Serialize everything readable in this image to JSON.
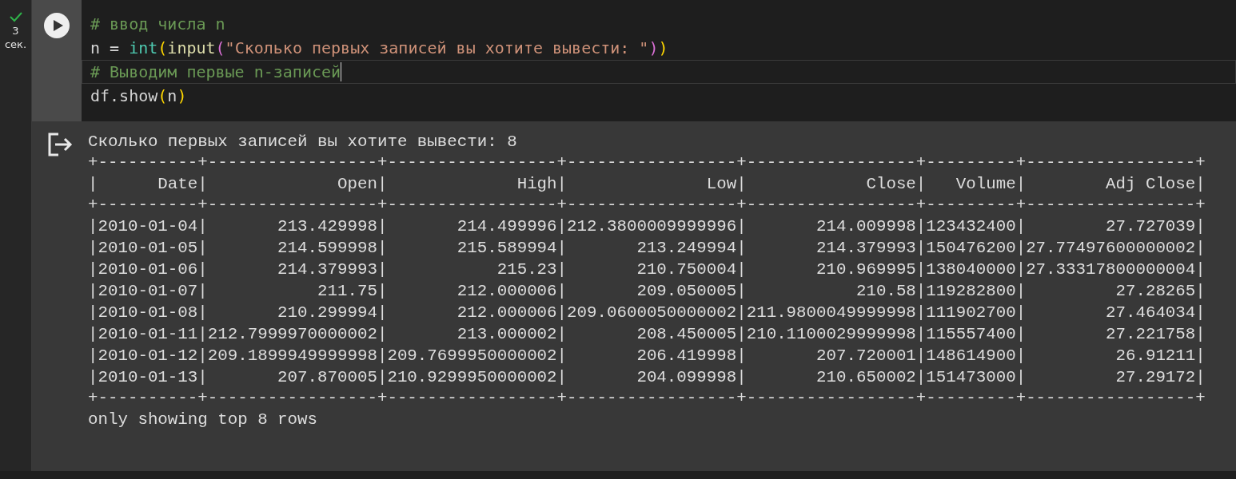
{
  "cell": {
    "succeeded": true,
    "duration": "3 сек.",
    "code": [
      {
        "current": false,
        "tokens": [
          {
            "kind": "comment",
            "text": "# ввод числа n"
          }
        ]
      },
      {
        "current": false,
        "tokens": [
          {
            "kind": "plain",
            "text": "n = "
          },
          {
            "kind": "builtin",
            "text": "int"
          },
          {
            "kind": "bracket1",
            "text": "("
          },
          {
            "kind": "function",
            "text": "input"
          },
          {
            "kind": "bracket2",
            "text": "("
          },
          {
            "kind": "string",
            "text": "\"Сколько первых записей вы хотите вывести: \""
          },
          {
            "kind": "bracket2",
            "text": ")"
          },
          {
            "kind": "bracket1",
            "text": ")"
          }
        ]
      },
      {
        "current": true,
        "tokens": [
          {
            "kind": "comment",
            "text": "# Выводим первые n-записей"
          }
        ]
      },
      {
        "current": false,
        "tokens": [
          {
            "kind": "plain",
            "text": "df.show"
          },
          {
            "kind": "bracket1",
            "text": "("
          },
          {
            "kind": "plain",
            "text": "n"
          },
          {
            "kind": "bracket1",
            "text": ")"
          }
        ]
      }
    ],
    "output": {
      "lines": [
        {
          "kind": "text",
          "text": "Сколько первых записей вы хотите вывести: 8"
        },
        {
          "kind": "border",
          "text": "+----------+-----------------+-----------------+-----------------+-----------------+---------+-----------------+"
        },
        {
          "kind": "header",
          "text": "|      Date|             Open|             High|              Low|            Close|   Volume|        Adj Close|"
        },
        {
          "kind": "border",
          "text": "+----------+-----------------+-----------------+-----------------+-----------------+---------+-----------------+"
        },
        {
          "kind": "row",
          "text": "|2010-01-04|       213.429998|       214.499996|212.3800009999996|       214.009998|123432400|        27.727039|"
        },
        {
          "kind": "row",
          "text": "|2010-01-05|       214.599998|       215.589994|       213.249994|       214.379993|150476200|27.77497600000002|"
        },
        {
          "kind": "row",
          "text": "|2010-01-06|       214.379993|           215.23|       210.750004|       210.969995|138040000|27.33317800000004|"
        },
        {
          "kind": "row",
          "text": "|2010-01-07|           211.75|       212.000006|       209.050005|           210.58|119282800|         27.28265|"
        },
        {
          "kind": "row",
          "text": "|2010-01-08|       210.299994|       212.000006|209.0600050000002|211.9800049999998|111902700|        27.464034|"
        },
        {
          "kind": "row",
          "text": "|2010-01-11|212.7999970000002|       213.000002|       208.450005|210.1100029999998|115557400|        27.221758|"
        },
        {
          "kind": "row",
          "text": "|2010-01-12|209.1899949999998|209.7699950000002|       206.419998|       207.720001|148614900|         26.91211|"
        },
        {
          "kind": "row",
          "text": "|2010-01-13|       207.870005|210.9299950000002|       204.099998|       210.650002|151473000|         27.29172|"
        },
        {
          "kind": "border",
          "text": "+----------+-----------------+-----------------+-----------------+-----------------+---------+-----------------+"
        },
        {
          "kind": "text",
          "text": "only showing top 8 rows"
        }
      ]
    }
  }
}
